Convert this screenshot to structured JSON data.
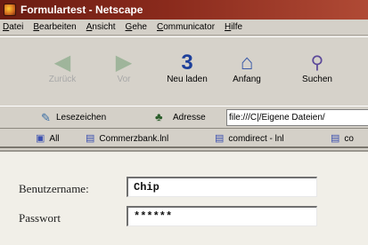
{
  "window": {
    "title": "Formulartest - Netscape"
  },
  "menu": {
    "items": [
      "Datei",
      "Bearbeiten",
      "Ansicht",
      "Gehe",
      "Communicator",
      "Hilfe"
    ]
  },
  "toolbar": {
    "buttons": [
      {
        "label": "Zurück",
        "icon": "back-arrow-icon"
      },
      {
        "label": "Vor",
        "icon": "forward-arrow-icon"
      },
      {
        "label": "Neu laden",
        "icon": "reload-icon"
      },
      {
        "label": "Anfang",
        "icon": "home-icon"
      },
      {
        "label": "Suchen",
        "icon": "search-icon"
      }
    ]
  },
  "location": {
    "bookmarks_label": "Lesezeichen",
    "address_label": "Adresse",
    "url": "file:///C|/Eigene Dateien/"
  },
  "personal_toolbar": {
    "items": [
      "All",
      "Commerzbank.lnl",
      "comdirect - lnl",
      "co"
    ]
  },
  "form": {
    "username_label": "Benutzername:",
    "username_value": "Chip",
    "password_label": "Passwort",
    "password_value": "******"
  }
}
